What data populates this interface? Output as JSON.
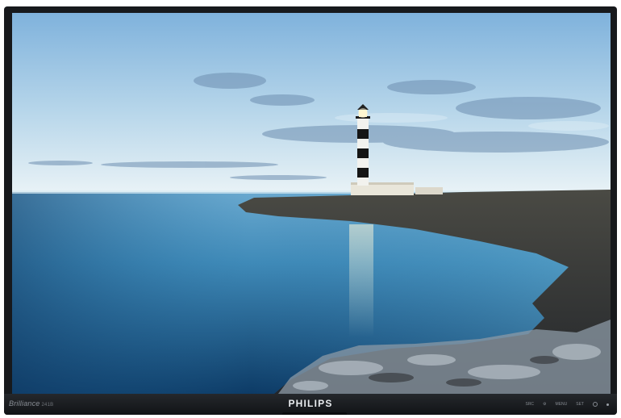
{
  "monitor": {
    "brand": "PHILIPS",
    "model_name": "Brilliance",
    "model_number": "241B",
    "buttons": [
      {
        "label": "SRC"
      },
      {
        "label": "⚙"
      },
      {
        "label": "MENU"
      },
      {
        "label": "SET"
      }
    ]
  },
  "wallpaper": {
    "subject": "lighthouse on rocky coast by calm sea",
    "colors": {
      "sky_top": "#8dbbe0",
      "sky_horizon": "#e8f2f6",
      "sea_deep": "#0f3d66",
      "sea_light": "#5aa6cc",
      "rock": "#3a3a36",
      "lighthouse_black": "#151515",
      "lighthouse_white": "#f2f2ee"
    }
  },
  "icons": {
    "power": "power-icon",
    "led": "power-led-icon"
  }
}
